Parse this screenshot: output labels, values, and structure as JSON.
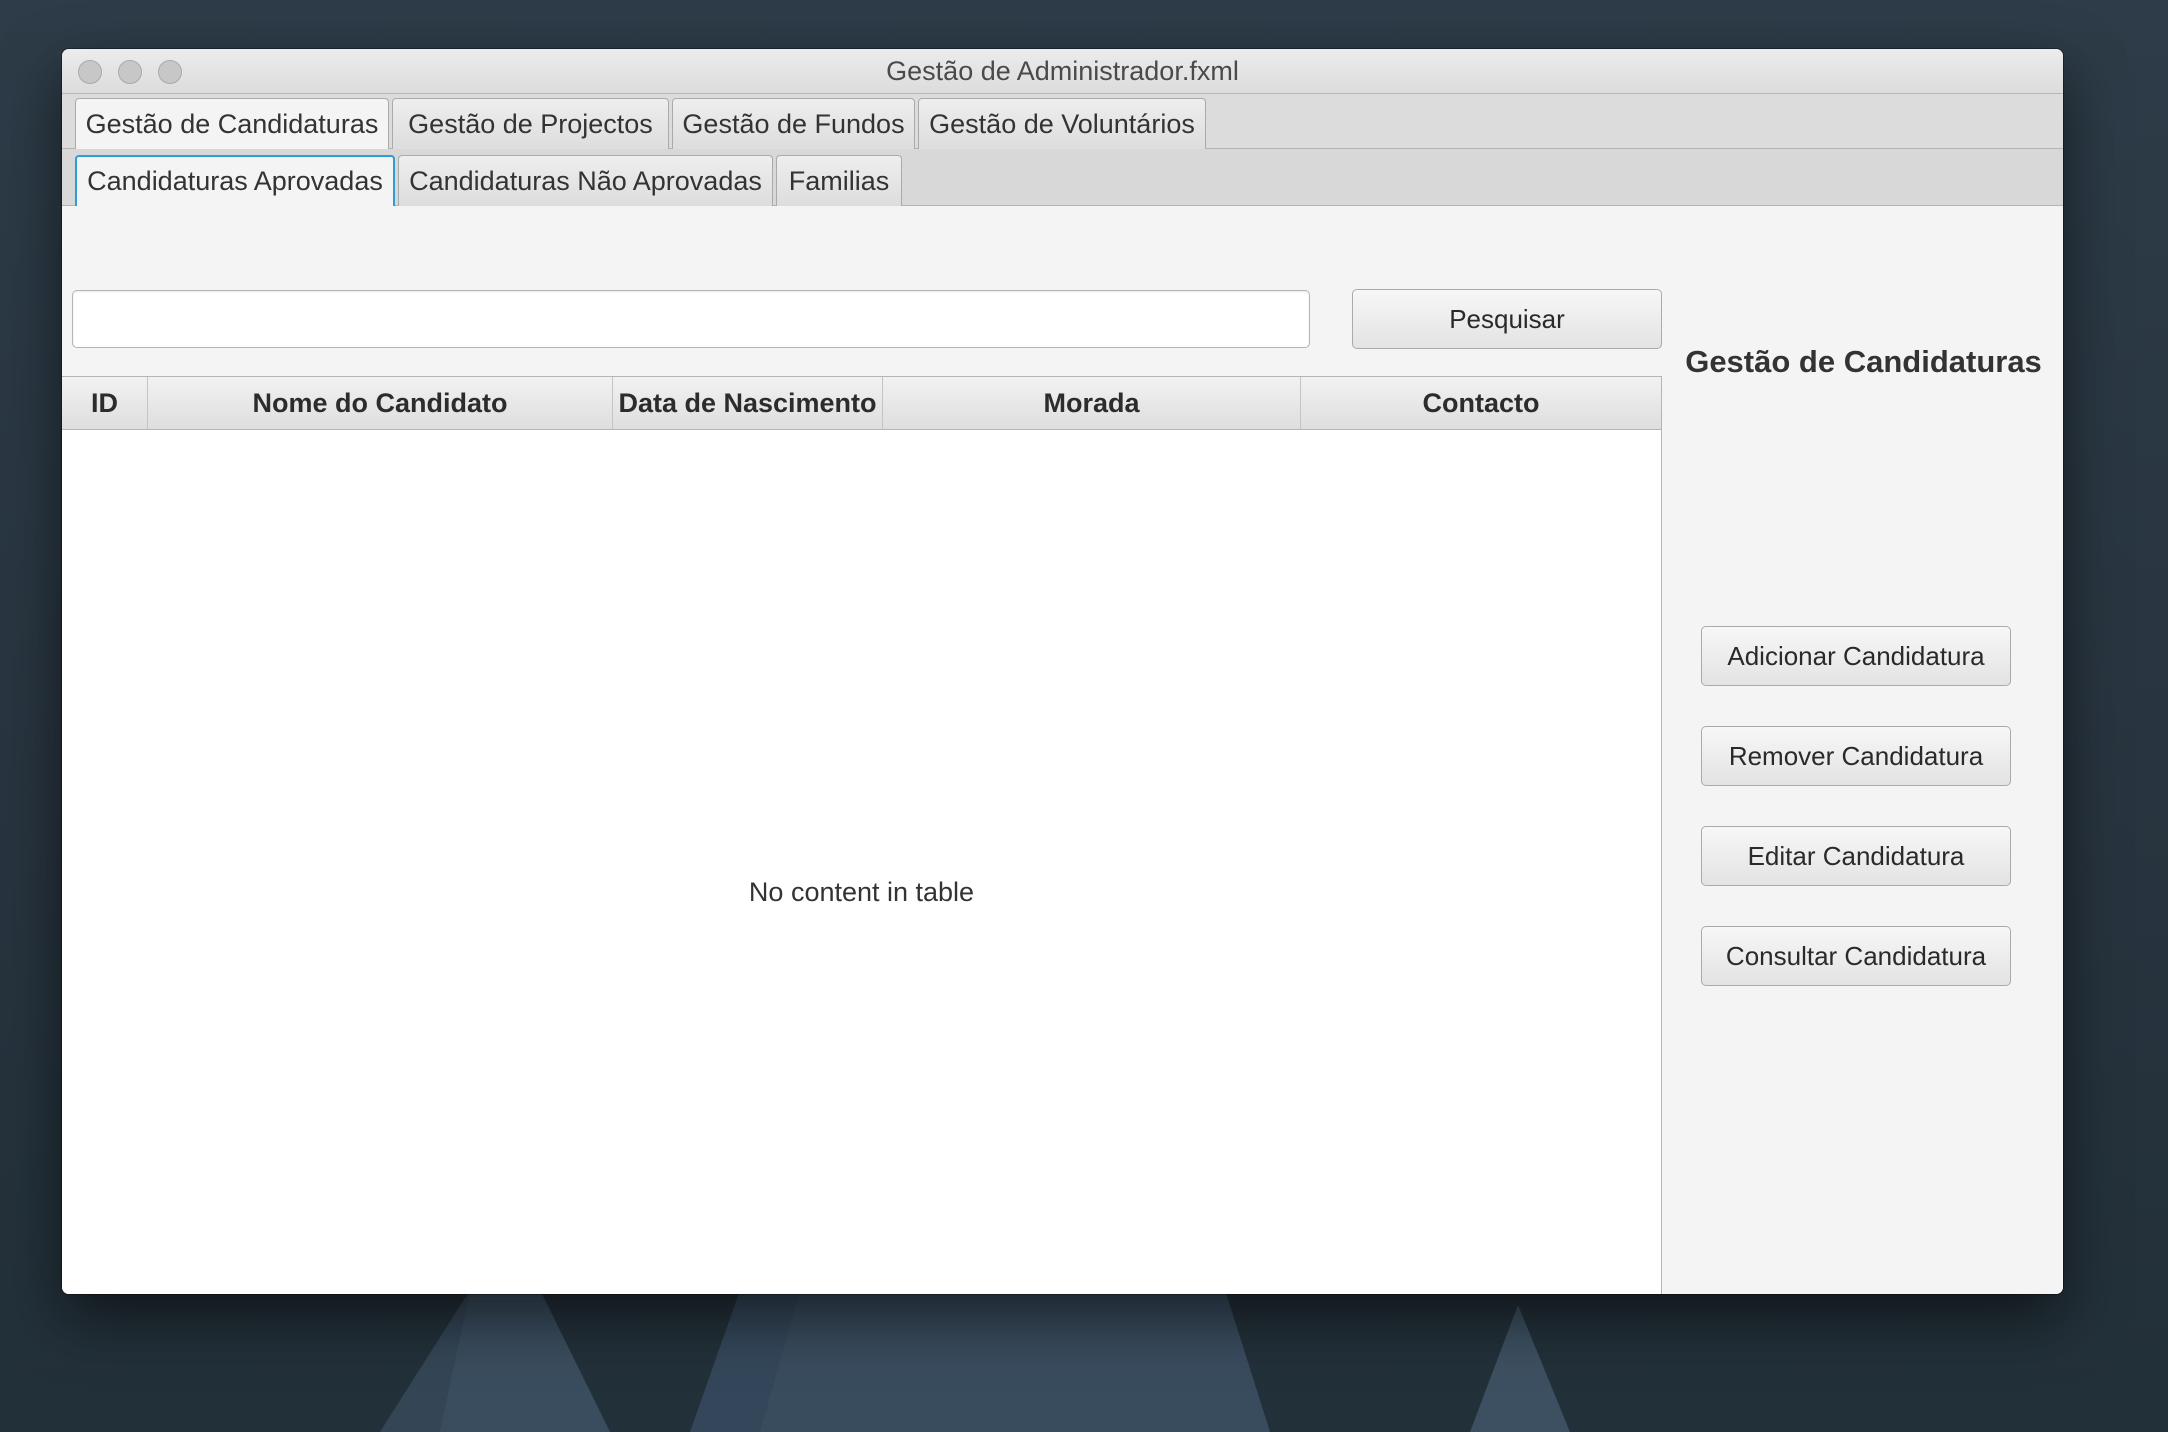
{
  "window": {
    "title": "Gestão de Administrador.fxml"
  },
  "main_tabs": [
    {
      "label": "Gestão de Candidaturas",
      "selected": true
    },
    {
      "label": "Gestão de Projectos",
      "selected": false
    },
    {
      "label": "Gestão de Fundos",
      "selected": false
    },
    {
      "label": "Gestão de Voluntários",
      "selected": false
    }
  ],
  "sub_tabs": [
    {
      "label": "Candidaturas Aprovadas",
      "selected": true
    },
    {
      "label": "Candidaturas Não Aprovadas",
      "selected": false
    },
    {
      "label": "Familias",
      "selected": false
    }
  ],
  "search": {
    "value": "",
    "placeholder": "",
    "button_label": "Pesquisar"
  },
  "table": {
    "columns": [
      "ID",
      "Nome do Candidato",
      "Data de Nascimento",
      "Morada",
      "Contacto"
    ],
    "rows": [],
    "empty_message": "No content in table"
  },
  "side_panel": {
    "title": "Gestão de Candidaturas",
    "buttons": [
      "Adicionar Candidatura",
      "Remover Candidatura",
      "Editar Candidatura",
      "Consultar Candidatura"
    ]
  },
  "colors": {
    "focus_accent": "#2f9bd8",
    "desktop_background": "#2b3945",
    "window_background": "#f4f4f4"
  }
}
